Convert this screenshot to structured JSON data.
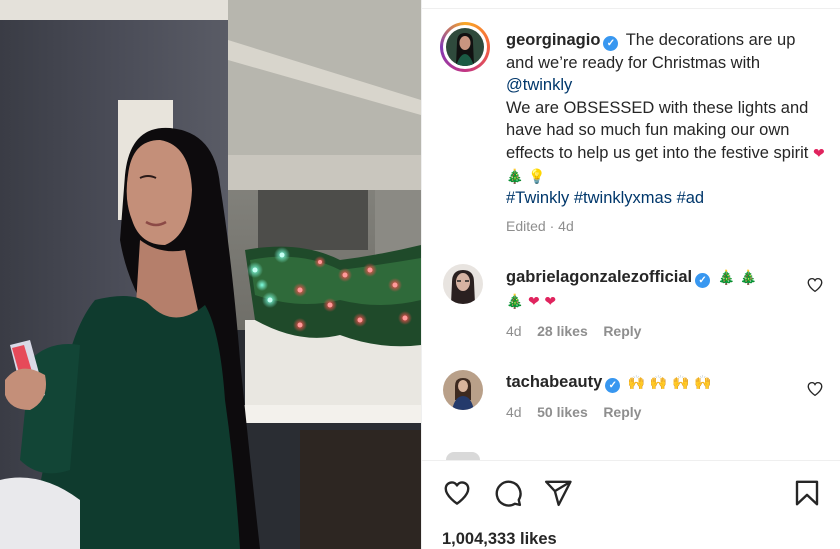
{
  "post": {
    "username": "georginagio",
    "verified_glyph": "✓",
    "caption_part1": "The decorations are up and we’re ready for Christmas with",
    "mention": "@twinkly",
    "caption_part2": "We are OBSESSED with these lights and have had so much fun making our own effects to help us get into the festive spirit",
    "caption_emojis": [
      "❤",
      "🎄",
      "💡"
    ],
    "hashtags": [
      "#Twinkly",
      "#twinklyxmas",
      "#ad"
    ],
    "edited_label": "Edited",
    "dot": "·",
    "age": "4d"
  },
  "comments": [
    {
      "username": "gabrielagonzalezofficial",
      "verified_glyph": "✓",
      "text_emojis": [
        "🎄",
        "🎄",
        "🎄",
        "❤",
        "❤"
      ],
      "age": "4d",
      "likes": "28 likes",
      "reply": "Reply"
    },
    {
      "username": "tachabeauty",
      "verified_glyph": "✓",
      "text_emojis": [
        "🙌",
        "🙌",
        "🙌",
        "🙌"
      ],
      "age": "4d",
      "likes": "50 likes",
      "reply": "Reply"
    }
  ],
  "actions": {
    "icons": [
      "heart-icon",
      "comment-icon",
      "share-icon",
      "bookmark-icon"
    ]
  },
  "likes_count": "1,004,333 likes",
  "colors": {
    "verified": "#3897f0",
    "link": "#00376b",
    "muted": "#8e8e8e",
    "text": "#262626"
  }
}
